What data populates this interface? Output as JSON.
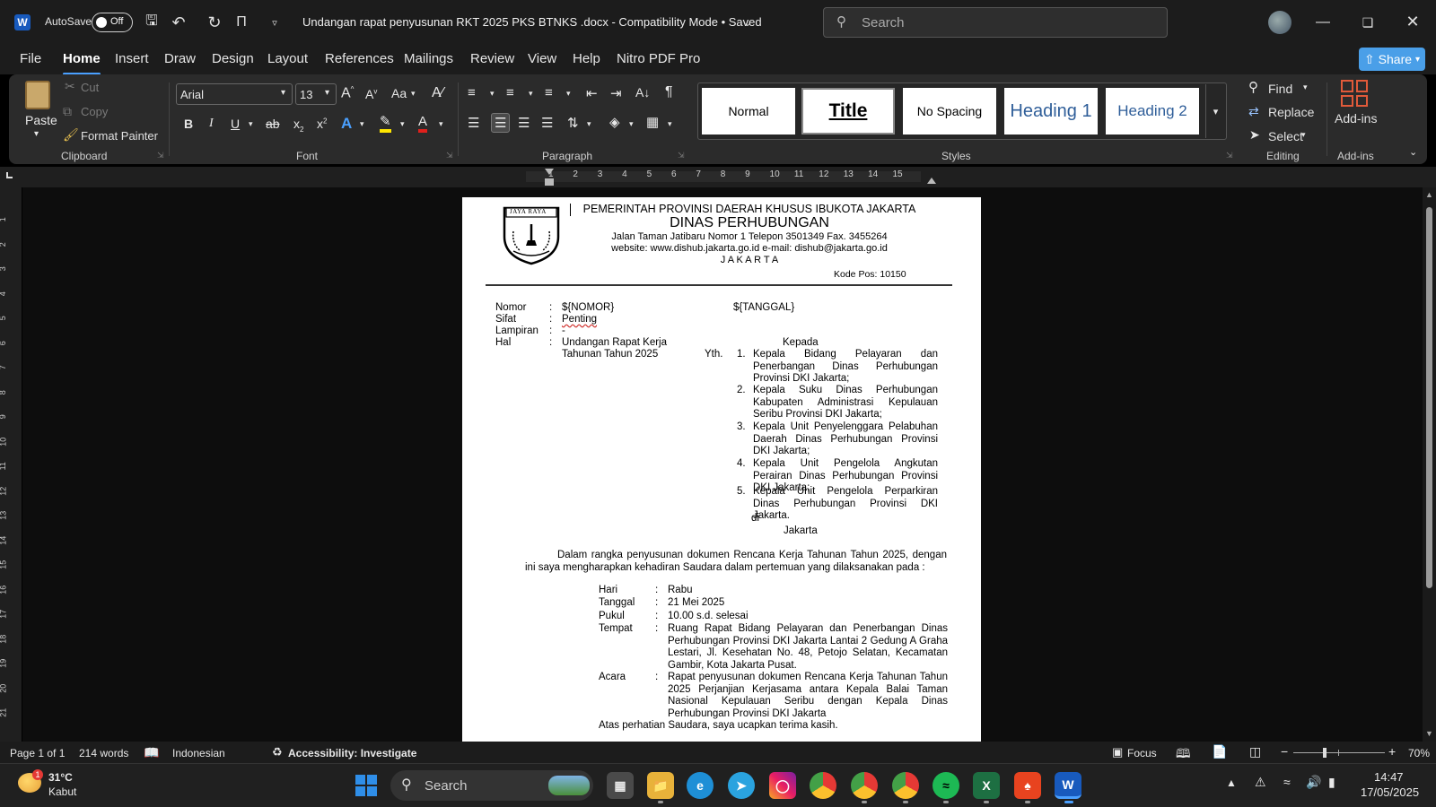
{
  "titlebar": {
    "autosave_label": "AutoSave",
    "autosave_state": "Off",
    "doc_title": "Undangan rapat penyusunan RKT 2025 PKS BTNKS .docx  -  Compatibility Mode • Saved",
    "search_placeholder": "Search"
  },
  "menu_tabs": [
    "File",
    "Home",
    "Insert",
    "Draw",
    "Design",
    "Layout",
    "References",
    "Mailings",
    "Review",
    "View",
    "Help",
    "Nitro PDF Pro"
  ],
  "share_label": "Share",
  "clipboard": {
    "paste": "Paste",
    "cut": "Cut",
    "copy": "Copy",
    "format_painter": "Format Painter",
    "group": "Clipboard"
  },
  "font": {
    "name": "Arial",
    "size": "13",
    "group": "Font",
    "case": "Aa"
  },
  "paragraph_group": "Paragraph",
  "styles": {
    "items": [
      "Normal",
      "Title",
      "No Spacing",
      "Heading 1",
      "Heading 2"
    ],
    "group": "Styles"
  },
  "editing": {
    "find": "Find",
    "replace": "Replace",
    "select": "Select",
    "group": "Editing"
  },
  "addins": {
    "label": "Add-ins",
    "group": "Add-ins"
  },
  "ruler_numbers": [
    "1",
    "2",
    "3",
    "4",
    "5",
    "6",
    "7",
    "8",
    "9",
    "10",
    "11",
    "12",
    "13",
    "14",
    "15"
  ],
  "vruler_numbers": [
    "1",
    "2",
    "3",
    "4",
    "5",
    "6",
    "7",
    "8",
    "9",
    "10",
    "11",
    "12",
    "13",
    "14",
    "15",
    "16",
    "17",
    "18",
    "19",
    "20",
    "21"
  ],
  "doc": {
    "seal": "JAYA RAYA",
    "header1": "PEMERINTAH PROVINSI DAERAH KHUSUS IBUKOTA JAKARTA",
    "header2": "DINAS  PERHUBUNGAN",
    "header3": "Jalan Taman Jatibaru Nomor 1 Telepon 3501349 Fax. 3455264",
    "header4": "website: www.dishub.jakarta.go.id e-mail: dishub@jakarta.go.id",
    "header5": "J A K A R T A",
    "kode_pos": "Kode Pos: 10150",
    "nomor_label": "Nomor",
    "nomor_val": "${NOMOR}",
    "tanggal_val": "${TANGGAL}",
    "sifat_label": "Sifat",
    "sifat_val": "Penting",
    "lampiran_label": "Lampiran",
    "lampiran_val": "-",
    "hal_label": "Hal",
    "hal_val1": "Undangan Rapat Kerja",
    "hal_val2": "Tahunan Tahun 2025",
    "colon": ":",
    "kepada": "Kepada",
    "yth": "Yth.",
    "recipients": [
      "Kepala Bidang Pelayaran dan Penerbangan Dinas Perhubungan Provinsi DKI Jakarta;",
      "Kepala Suku Dinas Perhubungan Kabupaten Administrasi Kepulauan Seribu Provinsi DKI Jakarta;",
      "Kepala Unit Penyelenggara Pelabuhan Daerah Dinas Perhubungan Provinsi DKI Jakarta;",
      "Kepala Unit Pengelola Angkutan Perairan Dinas Perhubungan Provinsi DKI Jakarta;",
      "Kepala Unit Pengelola Perparkiran Dinas Perhubungan Provinsi DKI Jakarta."
    ],
    "recipient_numbers": [
      "1.",
      "2.",
      "3.",
      "4.",
      "5."
    ],
    "di": "di",
    "kota": "Jakarta",
    "intro": "Dalam rangka penyusunan dokumen Rencana Kerja Tahunan Tahun 2025, dengan ini saya mengharapkan kehadiran Saudara dalam pertemuan yang dilaksanakan pada :",
    "hari_label": "Hari",
    "hari_val": "Rabu",
    "tgl_label": "Tanggal",
    "tgl_val": "21 Mei 2025",
    "pukul_label": "Pukul",
    "pukul_val": "10.00 s.d. selesai",
    "tempat_label": "Tempat",
    "tempat_val": "Ruang Rapat Bidang Pelayaran dan Penerbangan Dinas Perhubungan Provinsi DKI Jakarta Lantai 2 Gedung A Graha Lestari, Jl. Kesehatan No. 48, Petojo Selatan, Kecamatan Gambir, Kota Jakarta Pusat.",
    "acara_label": "Acara",
    "acara_val": "Rapat penyusunan dokumen Rencana Kerja Tahunan Tahun 2025 Perjanjian Kerjasama antara Kepala Balai Taman Nasional Kepulauan Seribu dengan Kepala Dinas Perhubungan Provinsi DKI Jakarta",
    "closing": "Atas perhatian Saudara, saya ucapkan terima kasih."
  },
  "status": {
    "page": "Page 1 of 1",
    "words": "214 words",
    "language": "Indonesian",
    "accessibility": "Accessibility: Investigate",
    "focus": "Focus",
    "zoom": "70%"
  },
  "taskbar": {
    "temp": "31°C",
    "weather": "Kabut",
    "search": "Search",
    "time": "14:47",
    "date": "17/05/2025",
    "weather_badge": "1"
  },
  "colors": {
    "accent": "#4aa0ff",
    "word_blue": "#185abd",
    "share_bg": "#4a9fe8"
  }
}
